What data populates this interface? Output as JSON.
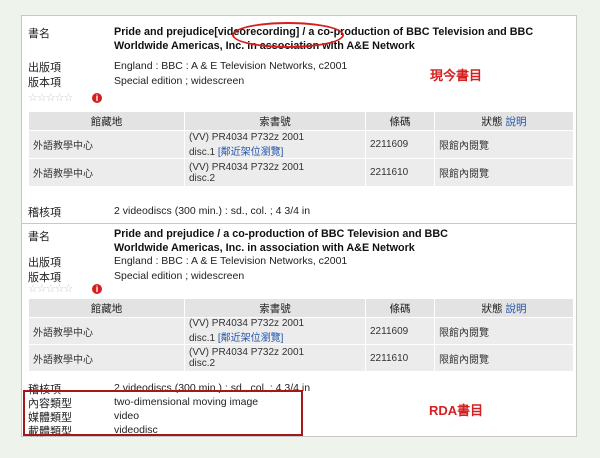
{
  "panel1": {
    "title_label": "書名",
    "title_pre": "Pride and prejudice",
    "title_gmd": "[videorecording]",
    "title_post": " / a co-production of BBC Television and BBC Worldwide Americas, Inc. in association with A&E Network",
    "pub_label": "出版項",
    "pub_value": "England : BBC : A & E Television Networks, c2001",
    "edition_label": "版本項",
    "edition_value": "Special edition ; widescreen",
    "annotation": "現今書目",
    "headers": [
      "館藏地",
      "索書號",
      "條碼",
      "狀態"
    ],
    "help_link": "說明",
    "rows": [
      {
        "location": "外語教學中心",
        "call_no_1": "(VV) PR4034 P732z 2001",
        "call_no_2": "disc.1",
        "shelf_link": "[鄰近架位瀏覽]",
        "barcode": "2211609",
        "status": "限館內閱覽"
      },
      {
        "location": "外語教學中心",
        "call_no_1": "(VV) PR4034 P732z 2001",
        "call_no_2": "disc.2",
        "barcode": "2211610",
        "status": "限館內閱覽"
      }
    ],
    "phys_label": "稽核項",
    "phys_value": "2 videodiscs (300 min.) : sd., col. ; 4 3/4 in"
  },
  "panel2": {
    "title_label": "書名",
    "title_line1": "Pride and prejudice / a co-production of BBC Television and BBC",
    "title_line2": "Worldwide Americas, Inc. in association with A&E Network",
    "pub_label": "出版項",
    "pub_value": "England : BBC : A & E Television Networks, c2001",
    "edition_label": "版本項",
    "edition_value": "Special edition ; widescreen",
    "headers": [
      "館藏地",
      "索書號",
      "條碼",
      "狀態"
    ],
    "help_link": "說明",
    "rows": [
      {
        "location": "外語教學中心",
        "call_no_1": "(VV) PR4034 P732z 2001",
        "call_no_2": "disc.1",
        "shelf_link": "[鄰近架位瀏覽]",
        "barcode": "2211609",
        "status": "限館內閱覽"
      },
      {
        "location": "外語教學中心",
        "call_no_1": "(VV) PR4034 P732z 2001",
        "call_no_2": "disc.2",
        "barcode": "2211610",
        "status": "限館內閱覽"
      }
    ],
    "phys_label": "稽核項",
    "phys_value": "2 videodiscs (300 min.) : sd., col. ; 4 3/4 in",
    "content_label": "內容類型",
    "content_value": "two-dimensional moving image",
    "media_label": "媒體類型",
    "media_value": "video",
    "carrier_label": "載體類型",
    "carrier_value": "videodisc",
    "annotation": "RDA書目"
  },
  "icons": {
    "star": "star-icon",
    "info": "info-icon"
  },
  "colors": {
    "highlight": "#d42020",
    "link": "#2255aa"
  }
}
